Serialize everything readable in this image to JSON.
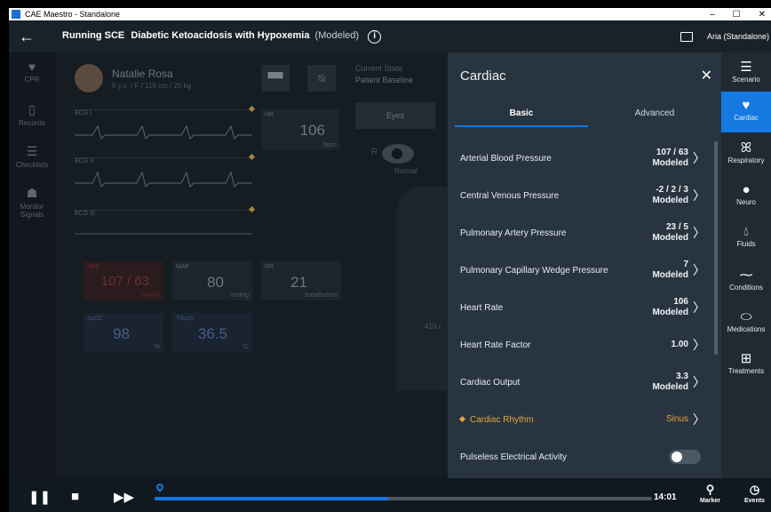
{
  "window": {
    "title": "CAE Maestro - Standalone",
    "minimize": "–",
    "maximize": "☐",
    "close": "✕"
  },
  "header": {
    "back_icon": "arrow-left-icon",
    "running_label": "Running SCE",
    "scenario_name": "Diabetic Ketoacidosis with Hypoxemia",
    "scenario_mode": "(Modeled)",
    "info_glyph": "i",
    "user": "Aria (Standalone)"
  },
  "left_nav": [
    {
      "label": "CPR",
      "icon": "heart-pulse-icon"
    },
    {
      "label": "Records",
      "icon": "clipboard-icon"
    },
    {
      "label": "Checklists",
      "icon": "checklist-icon"
    },
    {
      "label": "Monitor Signals",
      "icon": "person-signal-icon"
    }
  ],
  "patient": {
    "name": "Natalie Rosa",
    "info": "6 y.o. / F / 116 cm / 20 kg"
  },
  "ecg": {
    "lead1": "ECG I",
    "lead2": "ECG II",
    "lead3": "ECG III"
  },
  "vitals": {
    "hr": {
      "label": "HR",
      "value": "106",
      "unit": "bpm"
    },
    "abp": {
      "label": "ABP",
      "value": "107 / 63",
      "unit": "mmHg"
    },
    "map": {
      "label": "MAP",
      "value": "80",
      "unit": "mmHg"
    },
    "rr": {
      "label": "RR",
      "value": "21",
      "unit": "breaths/min"
    },
    "spo2": {
      "label": "SpO2",
      "value": "98",
      "unit": "%"
    },
    "tbody": {
      "label": "TBody",
      "value": "36.5",
      "unit": "°C"
    }
  },
  "state": {
    "title": "Current State",
    "value": "Patient Baseline",
    "eyes_button": "Eyes",
    "eye_side": "R",
    "eye_status": "Normal",
    "partial_value": "410 /"
  },
  "panel": {
    "title": "Cardiac",
    "tabs": {
      "basic": "Basic",
      "advanced": "Advanced"
    },
    "rows": [
      {
        "label": "Arterial Blood Pressure",
        "value": "107 / 63",
        "sub": "Modeled"
      },
      {
        "label": "Central Venous Pressure",
        "value": "-2 / 2 / 3",
        "sub": "Modeled"
      },
      {
        "label": "Pulmonary Artery Pressure",
        "value": "23 / 5",
        "sub": "Modeled"
      },
      {
        "label": "Pulmonary Capillary Wedge Pressure",
        "value": "7",
        "sub": "Modeled"
      },
      {
        "label": "Heart Rate",
        "value": "106",
        "sub": "Modeled"
      },
      {
        "label": "Heart Rate Factor",
        "value": "1.00",
        "sub": ""
      },
      {
        "label": "Cardiac Output",
        "value": "3.3",
        "sub": "Modeled"
      },
      {
        "label": "Cardiac Rhythm",
        "value": "Sinus",
        "sub": ""
      },
      {
        "label": "Pulseless Electrical Activity",
        "value": "",
        "sub": ""
      }
    ]
  },
  "right_nav": [
    {
      "label": "Scenario",
      "icon": "menu-icon"
    },
    {
      "label": "Cardiac",
      "icon": "heart-icon"
    },
    {
      "label": "Respiratory",
      "icon": "lungs-icon"
    },
    {
      "label": "Neuro",
      "icon": "brain-icon"
    },
    {
      "label": "Fluids",
      "icon": "droplet-icon"
    },
    {
      "label": "Conditions",
      "icon": "pulse-icon"
    },
    {
      "label": "Medications",
      "icon": "pill-icon"
    },
    {
      "label": "Treatments",
      "icon": "first-aid-icon"
    }
  ],
  "bottom": {
    "time": "14:01",
    "marker_label": "Marker",
    "events_label": "Events",
    "timeline_progress": 0.47
  },
  "colors": {
    "accent": "#1479e0",
    "warning": "#e8a33a",
    "panel_bg": "#283540"
  }
}
